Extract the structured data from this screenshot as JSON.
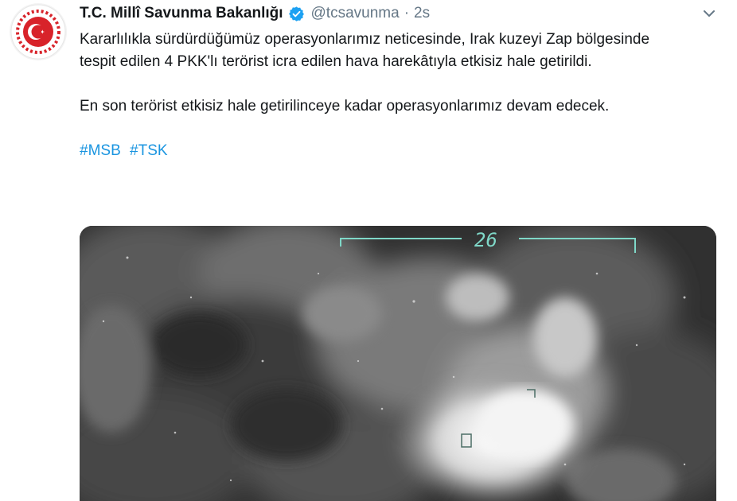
{
  "tweet": {
    "author_name": "T.C. Millî Savunma Bakanlığı",
    "handle": "@tcsavunma",
    "separator": "·",
    "time": "2s",
    "paragraphs": [
      "Kararlılıkla sürdürdüğümüz operasyonlarımız neticesinde, Irak kuzeyi Zap bölgesinde tespit edilen 4 PKK'lı terörist icra edilen hava harekâtıyla etkisiz hale getirildi.",
      "En son terörist etkisiz hale getirilinceye kadar operasyonlarımız devam edecek."
    ],
    "hashtags": [
      "#MSB",
      "#TSK"
    ]
  },
  "media": {
    "hud_number": "26",
    "hud_color": "#7fd8c8"
  },
  "colors": {
    "accent": "#1b95e0",
    "verified": "#1da1f2",
    "muted": "#657786",
    "logo_red": "#d8232a"
  },
  "icons": {
    "verified": "verified-badge-icon",
    "caret": "chevron-down-icon",
    "avatar": "crescent-star-emblem"
  }
}
